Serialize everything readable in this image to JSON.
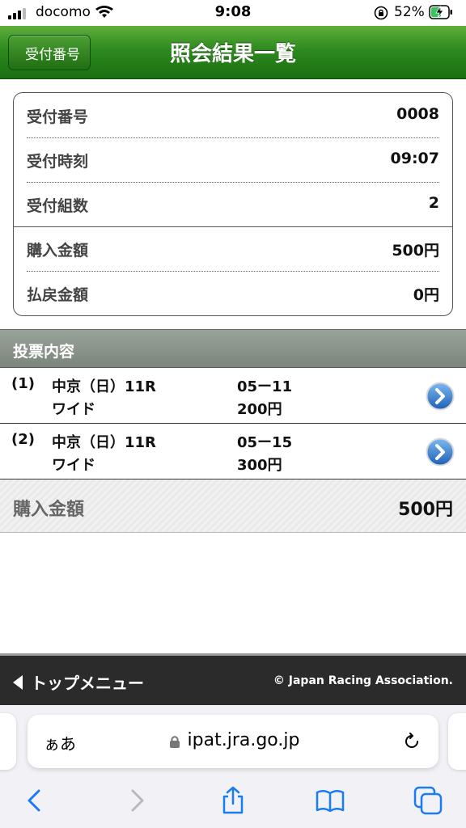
{
  "status_bar": {
    "carrier": "docomo",
    "time": "9:08",
    "battery_percent": "52%"
  },
  "header": {
    "back_label": "受付番号",
    "title": "照会結果一覧"
  },
  "summary": {
    "rows": [
      {
        "label": "受付番号",
        "value": "0008"
      },
      {
        "label": "受付時刻",
        "value": "09:07"
      },
      {
        "label": "受付組数",
        "value": "2"
      },
      {
        "label": "購入金額",
        "value": "500円"
      },
      {
        "label": "払戻金額",
        "value": "0円"
      }
    ]
  },
  "votes": {
    "section_title": "投票内容",
    "items": [
      {
        "index": "(1)",
        "race": "中京（日）11R",
        "bet_type": "ワイド",
        "combination": "05ー11",
        "amount": "200円"
      },
      {
        "index": "(2)",
        "race": "中京（日）11R",
        "bet_type": "ワイド",
        "combination": "05ー15",
        "amount": "300円"
      }
    ]
  },
  "total": {
    "label": "購入金額",
    "value": "500円"
  },
  "footer": {
    "top_menu_label": "トップメニュー",
    "copyright": "© Japan Racing Association."
  },
  "browser": {
    "text_size_label": "ぁあ",
    "url": "ipat.jra.go.jp"
  },
  "colors": {
    "header_green": "#2e8a1f",
    "section_gray": "#8a938b",
    "footer_dark": "#2b2b2b",
    "ios_blue": "#1a7cf5"
  },
  "icons": {
    "nav_arrow": "chevron-right-circle-icon",
    "back": "chevron-left-icon",
    "forward": "chevron-right-icon",
    "share": "share-icon",
    "bookmarks": "book-icon",
    "tabs": "tabs-icon"
  }
}
